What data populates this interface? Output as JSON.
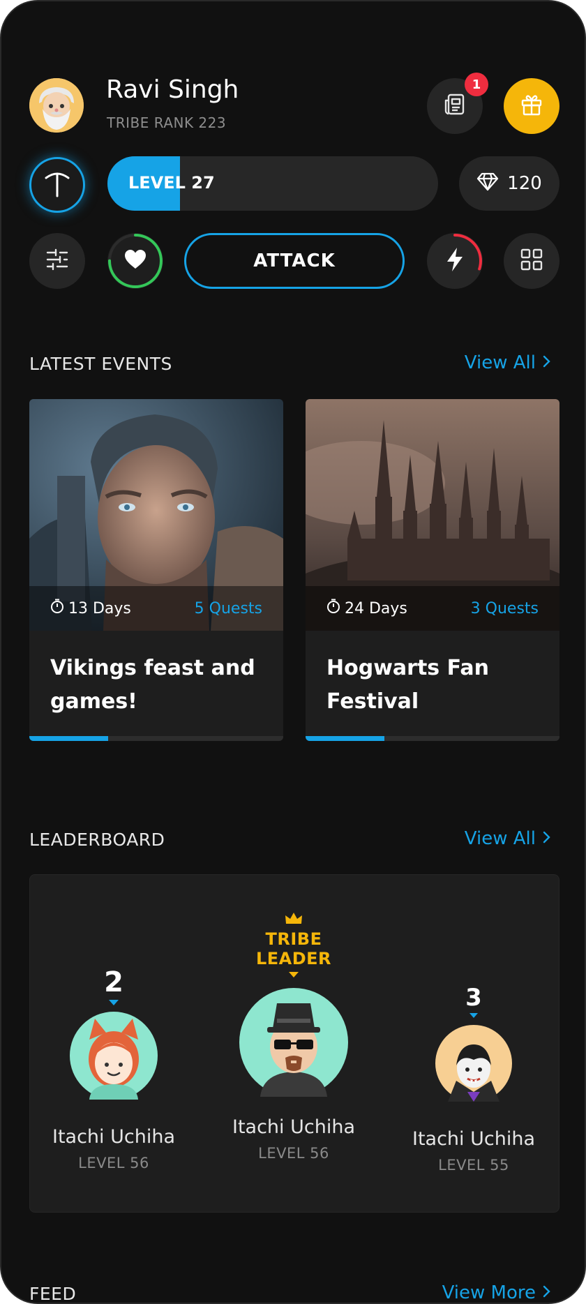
{
  "profile": {
    "name": "Ravi Singh",
    "rank": "TRIBE RANK 223",
    "notifications": "1"
  },
  "stats": {
    "level_label": "LEVEL 27",
    "level_progress": 0.22,
    "gems": "120"
  },
  "actions": {
    "attack_label": "ATTACK",
    "health_level": 0.75,
    "energy_level": 0.3
  },
  "events_section": {
    "title": "LATEST EVENTS",
    "view_label": "View All",
    "items": [
      {
        "days": "13 Days",
        "quests": "5 Quests",
        "title": "Vikings feast and games!",
        "progress": 0.31
      },
      {
        "days": "24 Days",
        "quests": "3 Quests",
        "title": "Hogwarts Fan Festival",
        "progress": 0.31
      }
    ]
  },
  "leaderboard": {
    "title": "LEADERBOARD",
    "view_label": "View All",
    "leader_label_line1": "TRIBE",
    "leader_label_line2": "LEADER",
    "players": [
      {
        "rank": "2",
        "name": "Itachi Uchiha",
        "level": "LEVEL 56"
      },
      {
        "rank": "1",
        "name": "Itachi Uchiha",
        "level": "LEVEL 56"
      },
      {
        "rank": "3",
        "name": "Itachi Uchiha",
        "level": "LEVEL 55"
      }
    ]
  },
  "feed": {
    "title": "FEED",
    "view_label": "View More"
  },
  "colors": {
    "accent": "#16a3e6",
    "gold": "#f5b60a",
    "background": "#111111",
    "card": "#1e1e1e",
    "badge": "#ef2d3f",
    "health": "#34c759",
    "energy": "#ef2d3f"
  }
}
